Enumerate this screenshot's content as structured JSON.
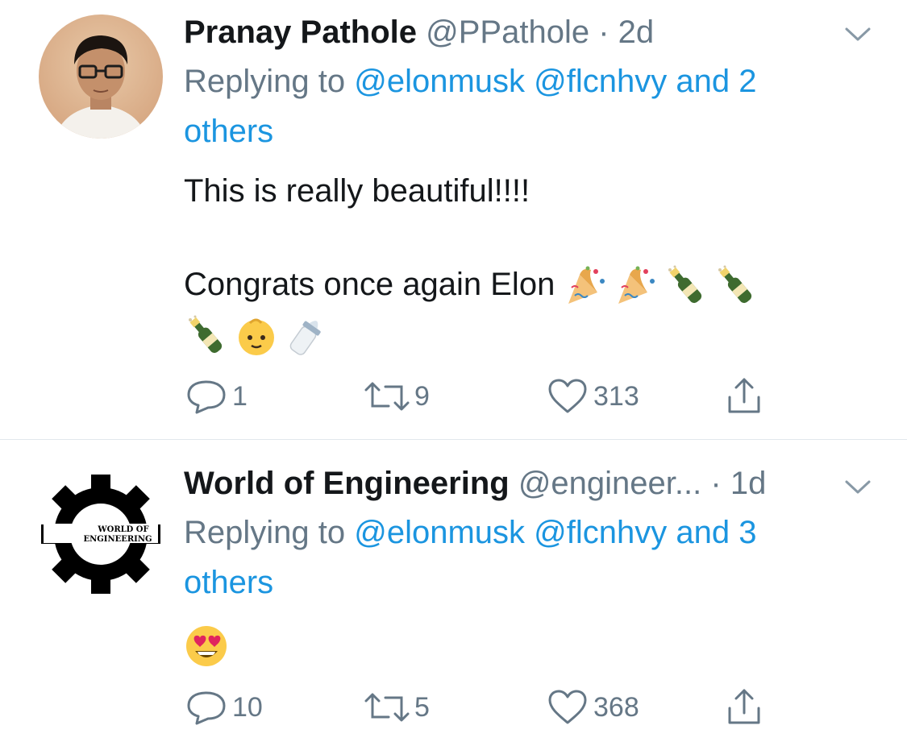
{
  "tweets": [
    {
      "name": "Pranay Pathole",
      "handle": "@PPathole",
      "separator": "·",
      "time": "2d",
      "replying_prefix": "Replying to ",
      "replying_users": [
        "@elonmusk",
        "@flcnhvy"
      ],
      "replying_more": "and 2 others",
      "text_line1": "This is really beautiful!!!!",
      "text_line2": "Congrats once again Elon",
      "emojis": [
        "party-popper-emoji",
        "party-popper-emoji",
        "champagne-emoji",
        "champagne-emoji",
        "champagne-emoji",
        "baby-emoji",
        "baby-bottle-emoji"
      ],
      "actions": {
        "reply_count": "1",
        "retweet_count": "9",
        "like_count": "313"
      }
    },
    {
      "name": "World of Engineering",
      "handle": "@engineer...",
      "separator": "·",
      "time": "1d",
      "avatar_text_line1": "WORLD OF",
      "avatar_text_line2": "ENGINEERING",
      "replying_prefix": "Replying to ",
      "replying_users": [
        "@elonmusk",
        "@flcnhvy"
      ],
      "replying_more": "and 3 others",
      "emojis": [
        "heart-eyes-emoji"
      ],
      "actions": {
        "reply_count": "10",
        "retweet_count": "5",
        "like_count": "368"
      }
    }
  ],
  "colors": {
    "link": "#1b95e0",
    "secondary": "#657786",
    "primary_text": "#14171a",
    "divider": "#e1e8ed"
  }
}
